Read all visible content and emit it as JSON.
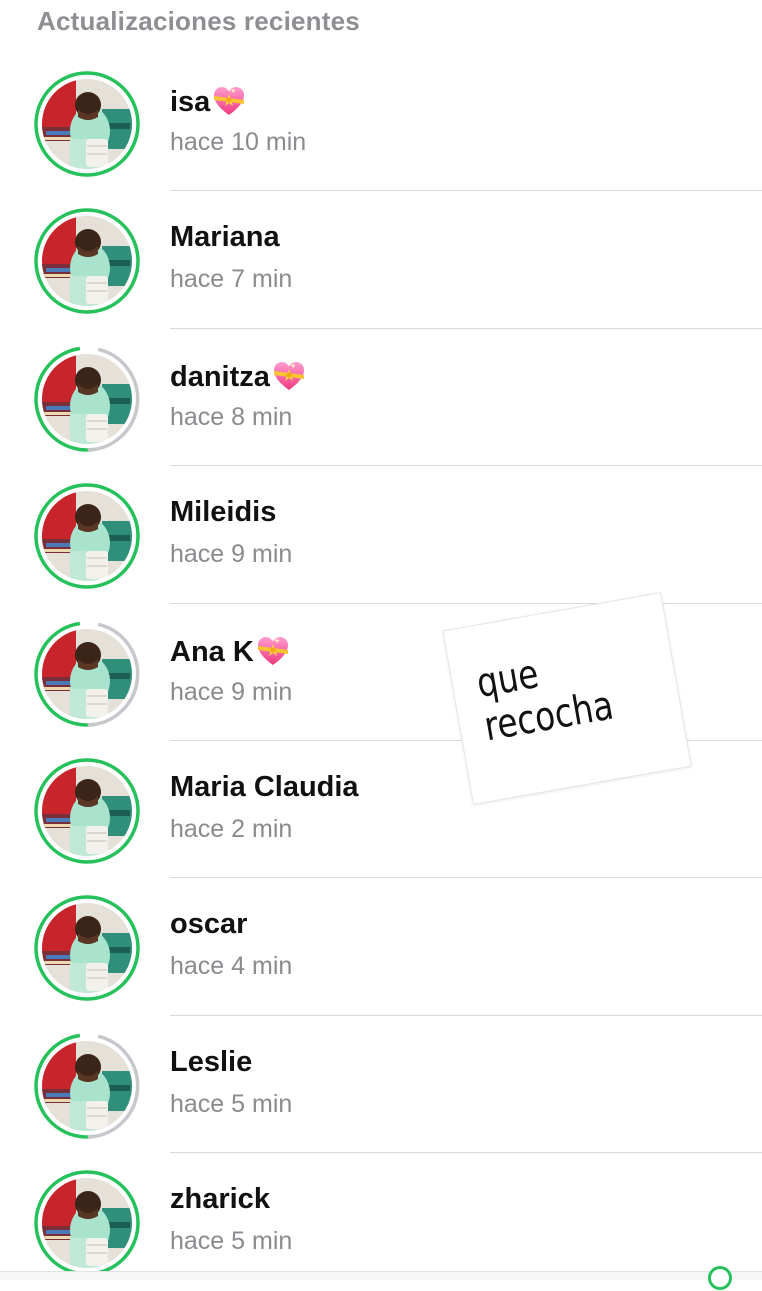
{
  "header": {
    "title": "Actualizaciones recientes"
  },
  "colors": {
    "ring_unseen": "#25c15b",
    "ring_seen": "#c7c7cc"
  },
  "updates": [
    {
      "name": "isa",
      "emoji": "sparkling-heart-icon",
      "time": "hace 10 min",
      "ring": "unseen"
    },
    {
      "name": "Mariana",
      "emoji": "",
      "time": "hace 7 min",
      "ring": "unseen"
    },
    {
      "name": "danitza",
      "emoji": "sparkling-heart-icon",
      "time": "hace 8 min",
      "ring": "partial"
    },
    {
      "name": "Mileidis",
      "emoji": "",
      "time": "hace 9 min",
      "ring": "unseen"
    },
    {
      "name": "Ana K",
      "emoji": "sparkling-heart-icon",
      "time": "hace 9 min",
      "ring": "partial"
    },
    {
      "name": "Maria Claudia",
      "emoji": "",
      "time": "hace 2 min",
      "ring": "unseen"
    },
    {
      "name": "oscar",
      "emoji": "",
      "time": "hace 4 min",
      "ring": "unseen"
    },
    {
      "name": "Leslie",
      "emoji": "",
      "time": "hace 5 min",
      "ring": "partial"
    },
    {
      "name": "zharick",
      "emoji": "",
      "time": "hace 5 min",
      "ring": "unseen"
    }
  ],
  "sticker": {
    "line1": "que",
    "line2": "recocha"
  }
}
